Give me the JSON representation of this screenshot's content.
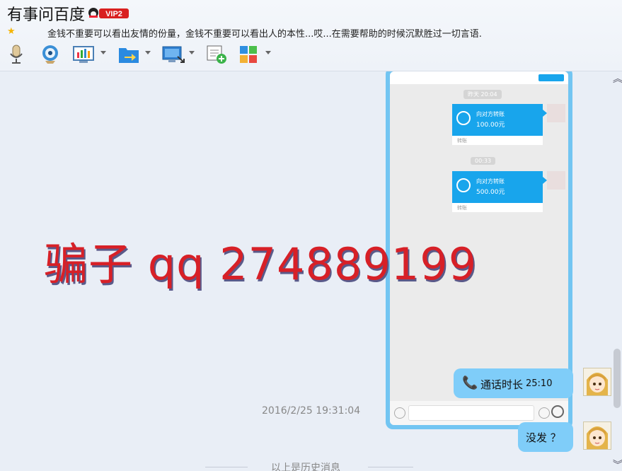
{
  "header": {
    "title": "有事问百度",
    "vip_badge": "VIP2",
    "signature": "金钱不重要可以看出友情的份量，金钱不重要可以看出人的本性...哎...在需要帮助的时候沉默胜过一切言语."
  },
  "toolbar": {
    "icons": [
      "microphone-icon",
      "video-camera-icon",
      "screen-share-icon",
      "file-transfer-icon",
      "remote-desktop-icon",
      "add-note-icon",
      "apps-grid-icon"
    ]
  },
  "screenshot": {
    "time1": "昨天 20:04",
    "transfer1": {
      "title": "向对方转账",
      "amount": "100.00元",
      "footer": "转账"
    },
    "time2": "00:33",
    "transfer2": {
      "title": "向对方转账",
      "amount": "500.00元",
      "footer": "转账"
    }
  },
  "watermark": "骗子 qq 274889199",
  "messages": {
    "call": {
      "label": "通话时长",
      "duration": "25:10"
    },
    "timestamp": "2016/2/25 19:31:04",
    "text": "没发 ？",
    "history_divider": "以上是历史消息"
  },
  "colors": {
    "bubble": "#7fcdf9",
    "transfer_blue": "#18a5ec",
    "watermark": "#d72027",
    "background": "#e9eef6"
  }
}
